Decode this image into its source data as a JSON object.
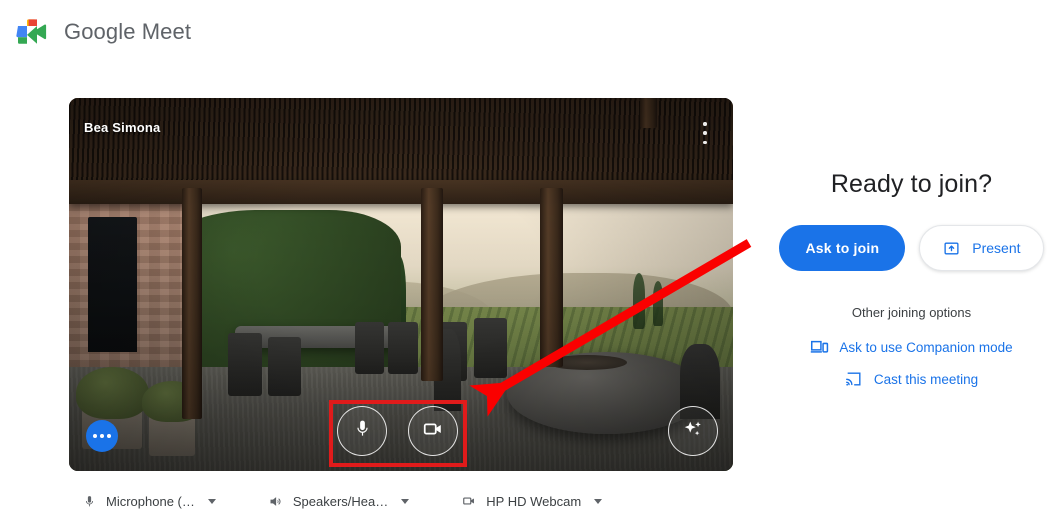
{
  "header": {
    "brand_google": "Google",
    "brand_product": " Meet",
    "logo_icon": "google-meet-logo"
  },
  "preview": {
    "participant_name": "Bea Simona",
    "more_menu_icon": "kebab-menu-icon",
    "mic_icon": "microphone-icon",
    "camera_icon": "video-camera-icon",
    "effects_icon": "sparkles-effects-icon",
    "more_options_icon": "more-horizontal-icon"
  },
  "devices": [
    {
      "icon": "microphone-icon",
      "label": "Microphone (…",
      "caret": "chevron-down-icon"
    },
    {
      "icon": "speaker-icon",
      "label": "Speakers/Hea…",
      "caret": "chevron-down-icon"
    },
    {
      "icon": "video-camera-icon",
      "label": "HP HD Webcam",
      "caret": "chevron-down-icon"
    }
  ],
  "join_panel": {
    "title": "Ready to join?",
    "ask_to_join_label": "Ask to join",
    "present_label": "Present",
    "present_icon": "present-screen-icon",
    "other_options_label": "Other joining options",
    "companion_mode_label": "Ask to use Companion mode",
    "companion_mode_icon": "companion-device-icon",
    "cast_label": "Cast this meeting",
    "cast_icon": "cast-icon"
  },
  "annotations": {
    "highlight_box": "red-highlight-rectangle",
    "arrow": "red-pointer-arrow"
  },
  "colors": {
    "brand_blue": "#1a73e8",
    "annotation_red": "#e01b1b",
    "text_primary": "#202124",
    "text_secondary": "#3c4043",
    "icon_gray": "#5f6368"
  }
}
